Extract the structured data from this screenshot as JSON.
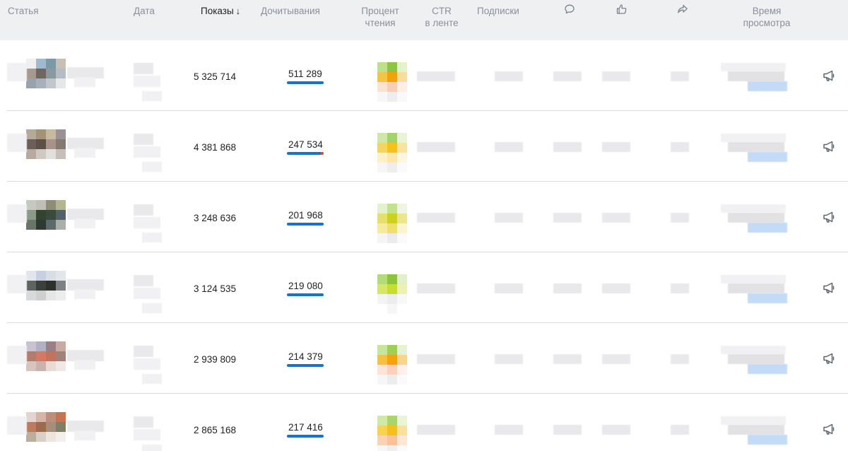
{
  "header": {
    "article": "Статья",
    "date": "Дата",
    "views": "Показы",
    "sort_arrow": "↓",
    "readthroughs": "Дочитывания",
    "read_percent_l1": "Процент",
    "read_percent_l2": "чтения",
    "ctr_l1": "CTR",
    "ctr_l2": "в ленте",
    "subscriptions": "Подписки",
    "comments_icon": "comment-icon",
    "likes_icon": "thumbs-up-icon",
    "shares_icon": "share-arrow-icon",
    "watch_time_l1": "Время",
    "watch_time_l2": "просмотра"
  },
  "rows": [
    {
      "views": "5 325 714",
      "readthroughs": "511 289",
      "readthrough_bar_fraction": 1.0,
      "promote_icon": "megaphone-icon"
    },
    {
      "views": "4 381 868",
      "readthroughs": "247 534",
      "readthrough_bar_fraction": 1.0,
      "promote_icon": "megaphone-icon"
    },
    {
      "views": "3 248 636",
      "readthroughs": "201 968",
      "readthrough_bar_fraction": 1.0,
      "promote_icon": "megaphone-icon"
    },
    {
      "views": "3 124 535",
      "readthroughs": "219 080",
      "readthrough_bar_fraction": 1.0,
      "promote_icon": "megaphone-icon"
    },
    {
      "views": "2 939 809",
      "readthroughs": "214 379",
      "readthrough_bar_fraction": 1.0,
      "promote_icon": "megaphone-icon"
    },
    {
      "views": "2 865 168",
      "readthroughs": "217 416",
      "readthrough_bar_fraction": 1.0,
      "promote_icon": "megaphone-icon"
    }
  ],
  "colors": {
    "header_bg": "#eff0f2",
    "accent_blue": "#1673d1",
    "bar_tail_red": "#e2502f",
    "row_separator": "#d9dbde"
  }
}
